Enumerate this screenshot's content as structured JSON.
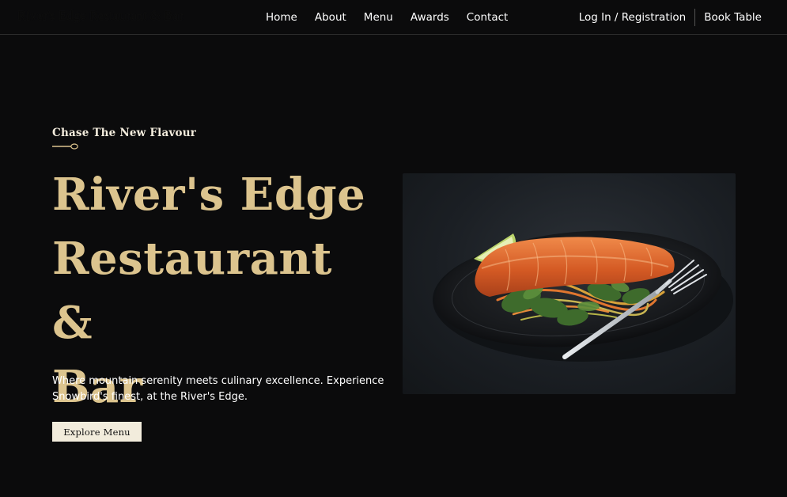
{
  "brand": {
    "name": "River's Edge Restaurant & Bar"
  },
  "nav": {
    "items": [
      "Home",
      "About",
      "Menu",
      "Awards",
      "Contact"
    ],
    "login_label": "Log In / Registration",
    "book_label": "Book Table"
  },
  "hero": {
    "kicker": "Chase The New Flavour",
    "title_lines": [
      "River's Edge",
      "Restaurant &",
      "Bar"
    ],
    "description": "Where mountain serenity meets culinary excellence. Experience Snowbird's finest, at the River's Edge.",
    "button_label": "Explore Menu",
    "image_subject": "salmon-fillet-with-greens-on-dark-plate"
  },
  "colors": {
    "background": "#0b0b0c",
    "accent_gold": "#dcc48e",
    "button_bg": "#f2ecdc",
    "text": "#ffffff"
  },
  "icons": {
    "divider": "spoon-icon"
  }
}
